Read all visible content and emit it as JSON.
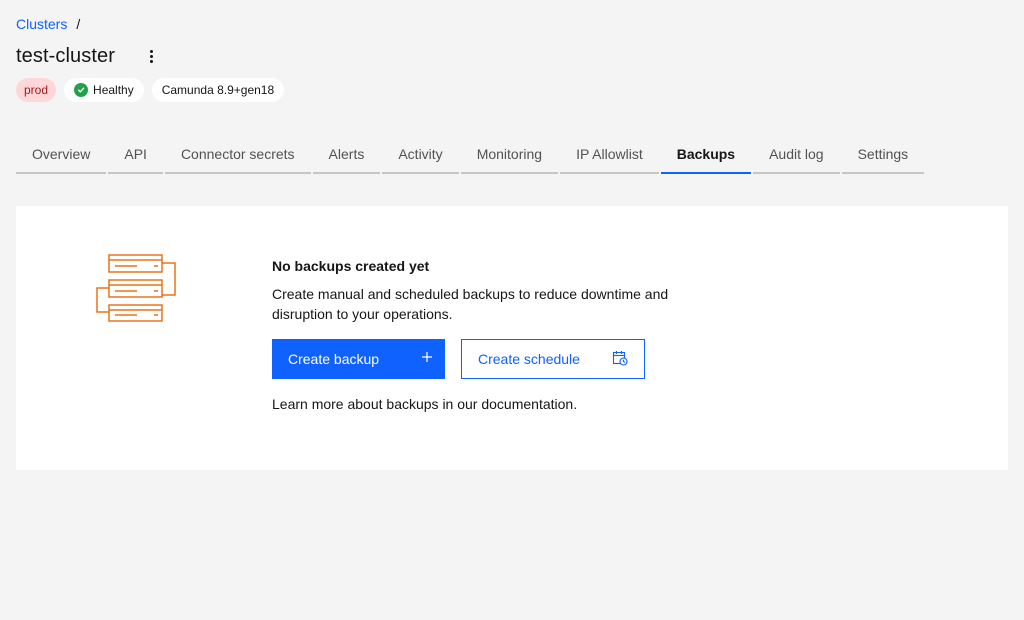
{
  "breadcrumb": {
    "parent": "Clusters",
    "separator": "/"
  },
  "cluster": {
    "name": "test-cluster"
  },
  "tags": {
    "environment": "prod",
    "health": "Healthy",
    "version": "Camunda 8.9+gen18"
  },
  "tabs": [
    {
      "label": "Overview"
    },
    {
      "label": "API"
    },
    {
      "label": "Connector secrets"
    },
    {
      "label": "Alerts"
    },
    {
      "label": "Activity"
    },
    {
      "label": "Monitoring"
    },
    {
      "label": "IP Allowlist"
    },
    {
      "label": "Backups"
    },
    {
      "label": "Audit log"
    },
    {
      "label": "Settings"
    }
  ],
  "active_tab": "Backups",
  "empty_state": {
    "heading": "No backups created yet",
    "description": "Create manual and scheduled backups to reduce downtime and disruption to your operations.",
    "primary_button": "Create backup",
    "secondary_button": "Create schedule",
    "learn_more": "Learn more about backups in our documentation."
  },
  "icons": {
    "overflow": "overflow-menu-vertical-icon",
    "health": "checkmark-filled-icon",
    "illustration": "server-stack-icon",
    "add": "add-icon",
    "schedule": "calendar-clock-icon"
  },
  "colors": {
    "primary": "#0f62fe",
    "success": "#24a148",
    "prod_tag_bg": "#ffd7d9",
    "prod_tag_text": "#a2191f",
    "illustration": "#e8731a",
    "background": "#f4f4f4"
  }
}
